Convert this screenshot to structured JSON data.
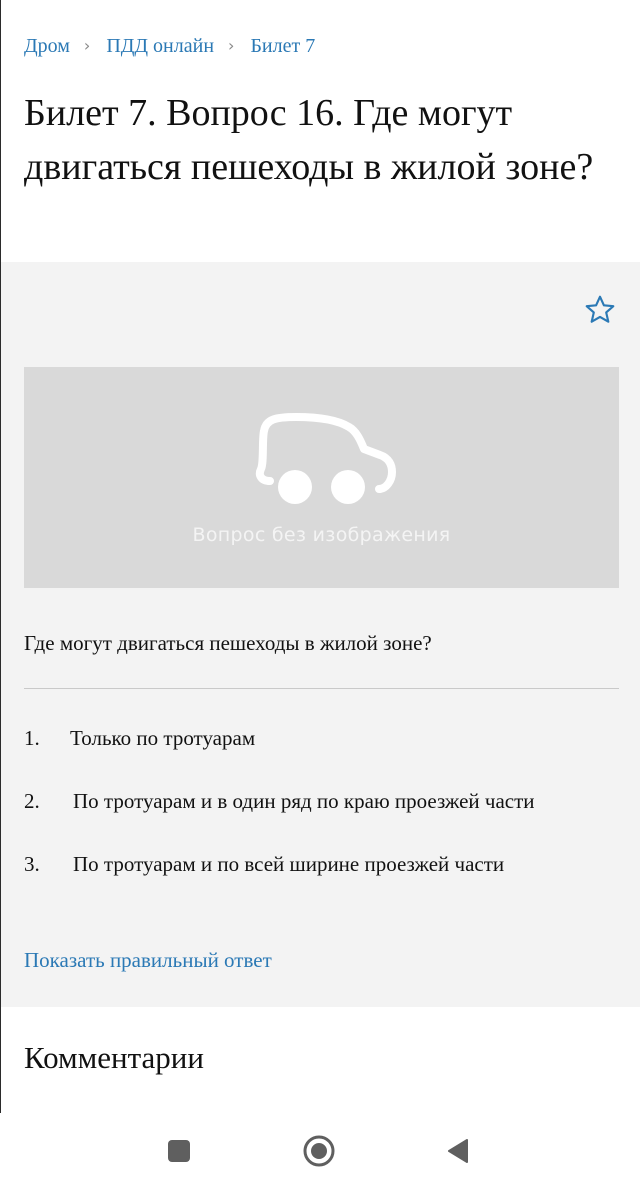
{
  "breadcrumb": {
    "items": [
      "Дром",
      "ПДД онлайн",
      "Билет 7"
    ],
    "separator": "›"
  },
  "page_title": "Билет 7. Вопрос 16. Где могут двигаться пешеходы в жилой зоне?",
  "question_card": {
    "favorite_icon": "star-outline-icon",
    "no_image_text": "Вопрос без изображения",
    "no_image_icon": "car-placeholder-icon",
    "question_text": "Где могут двигаться пешеходы в жилой зоне?",
    "answers": [
      {
        "number": "1.",
        "text": "Только по тротуарам"
      },
      {
        "number": "2.",
        "text": "По тротуарам и в один ряд по краю проезжей части"
      },
      {
        "number": "3.",
        "text": "По тротуарам и по всей ширине проезжей части"
      }
    ],
    "show_answer_link": "Показать правильный ответ"
  },
  "comments_heading": "Комментарии",
  "system_nav": {
    "recents_icon": "square-icon",
    "home_icon": "circle-home-icon",
    "back_icon": "triangle-back-icon"
  },
  "colors": {
    "link": "#2b79b5",
    "card_background": "#f3f3f3",
    "placeholder_background": "#d9d9d9"
  }
}
